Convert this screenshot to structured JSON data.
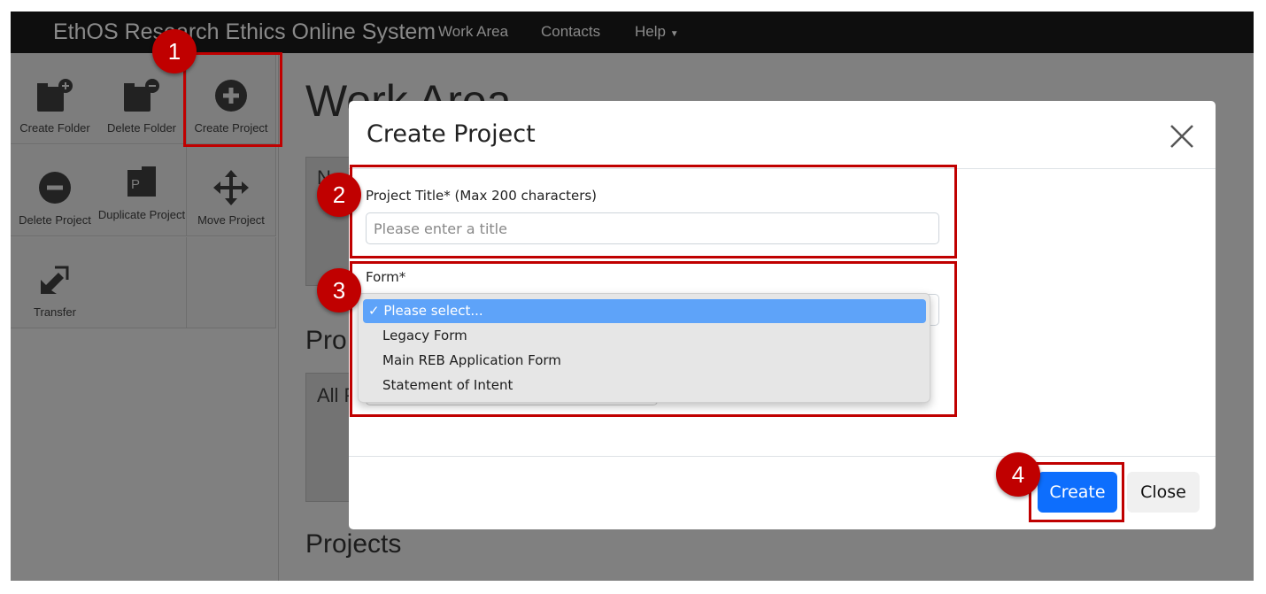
{
  "navbar": {
    "brand": "EthOS Research Ethics Online System",
    "links": [
      "Work Area",
      "Contacts",
      "Help"
    ]
  },
  "toolbar": {
    "tiles": [
      {
        "label": "Create Folder",
        "icon": "folder-plus-icon"
      },
      {
        "label": "Delete Folder",
        "icon": "folder-minus-icon"
      },
      {
        "label": "Create Project",
        "icon": "plus-circle-icon"
      },
      {
        "label": "Delete Project",
        "icon": "minus-circle-icon"
      },
      {
        "label": "Duplicate Project",
        "icon": "duplicate-icon"
      },
      {
        "label": "Move Project",
        "icon": "move-icon"
      },
      {
        "label": "Transfer",
        "icon": "transfer-icon"
      }
    ]
  },
  "background": {
    "page_title": "Work Area",
    "box1_text": "N",
    "section2": "Pro",
    "box2_text": "All P",
    "section3": "Projects"
  },
  "modal": {
    "title": "Create Project",
    "title_label": "Project Title* (Max 200 characters)",
    "title_placeholder": "Please enter a title",
    "title_value": "",
    "form_label": "Form*",
    "form_options": [
      "✓ Please select...",
      "Legacy Form",
      "Main REB Application Form",
      "Statement of Intent"
    ],
    "create_label": "Create",
    "close_label": "Close"
  },
  "annotations": [
    "1",
    "2",
    "3",
    "4"
  ],
  "colors": {
    "annotation": "#c00000",
    "primary": "#0d6efd",
    "highlight": "#5ea3f9"
  }
}
